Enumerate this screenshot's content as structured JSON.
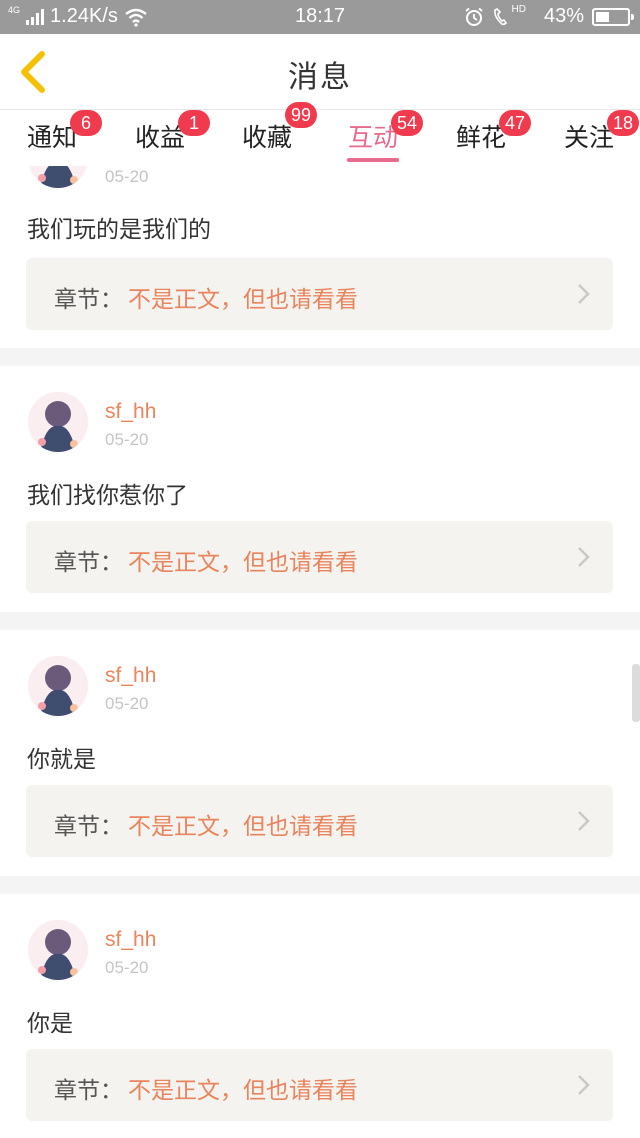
{
  "status_bar": {
    "network_tag": "4G",
    "speed": "1.24K/s",
    "time": "18:17",
    "hd_tag": "HD",
    "battery": "43%",
    "battery_level": 0.43
  },
  "header": {
    "title": "消息"
  },
  "tabs": [
    {
      "label": "通知",
      "badge": "6"
    },
    {
      "label": "收益",
      "badge": "1"
    },
    {
      "label": "收藏",
      "badge": "99"
    },
    {
      "label": "互动",
      "badge": "54",
      "active": true
    },
    {
      "label": "鲜花",
      "badge": "47"
    },
    {
      "label": "关注",
      "badge": "18"
    }
  ],
  "items": [
    {
      "username": "",
      "date": "05-20",
      "message": "我们玩的是我们的",
      "chapter_label": "章节：",
      "chapter_title": "不是正文，但也请看看"
    },
    {
      "username": "sf_hh",
      "date": "05-20",
      "message": "我们找你惹你了",
      "chapter_label": "章节：",
      "chapter_title": "不是正文，但也请看看"
    },
    {
      "username": "sf_hh",
      "date": "05-20",
      "message": "你就是",
      "chapter_label": "章节：",
      "chapter_title": "不是正文，但也请看看"
    },
    {
      "username": "sf_hh",
      "date": "05-20",
      "message": "你是",
      "chapter_label": "章节：",
      "chapter_title": "不是正文，但也请看看"
    }
  ],
  "colors": {
    "accent": "#e86a8d",
    "username": "#e9845c",
    "badge": "#f03a4d",
    "back_arrow": "#f5c000"
  }
}
